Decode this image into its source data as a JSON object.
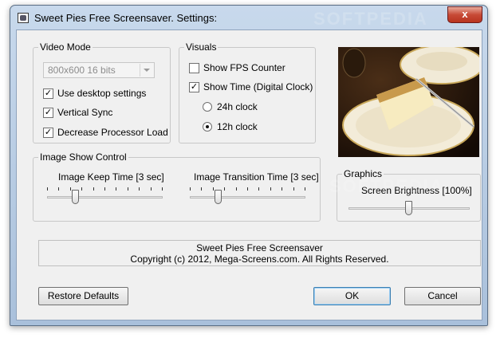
{
  "window": {
    "title": "Sweet Pies Free Screensaver. Settings:",
    "close_glyph": "x"
  },
  "video_mode": {
    "legend": "Video Mode",
    "resolution": "800x600 16 bits",
    "checkboxes": [
      {
        "label": "Use desktop settings",
        "checked": true
      },
      {
        "label": "Vertical Sync",
        "checked": true
      },
      {
        "label": "Decrease Processor Load",
        "checked": true
      }
    ]
  },
  "visuals": {
    "legend": "Visuals",
    "show_fps": {
      "label": "Show FPS Counter",
      "checked": false
    },
    "show_time": {
      "label": "Show Time (Digital Clock)",
      "checked": true
    },
    "clock_options": [
      {
        "label": "24h clock",
        "selected": false
      },
      {
        "label": "12h clock",
        "selected": true
      }
    ]
  },
  "image_show": {
    "legend": "Image Show Control",
    "keep_time": {
      "label": "Image Keep Time [3 sec]",
      "value_fraction": 0.25
    },
    "transition_time": {
      "label": "Image Transition Time [3 sec]",
      "value_fraction": 0.25
    }
  },
  "graphics": {
    "legend": "Graphics",
    "brightness": {
      "label": "Screen Brightness [100%]",
      "value_fraction": 0.5
    }
  },
  "info": {
    "line1": "Sweet Pies Free Screensaver",
    "line2": "Copyright (c) 2012, Mega-Screens.com. All Rights Reserved."
  },
  "buttons": {
    "restore": "Restore Defaults",
    "ok": "OK",
    "cancel": "Cancel"
  },
  "watermark": "SOFTPEDIA",
  "check_glyph": "✓",
  "colors": {
    "accent": "#3c7fb1",
    "titlebar": "#b9cde4"
  }
}
